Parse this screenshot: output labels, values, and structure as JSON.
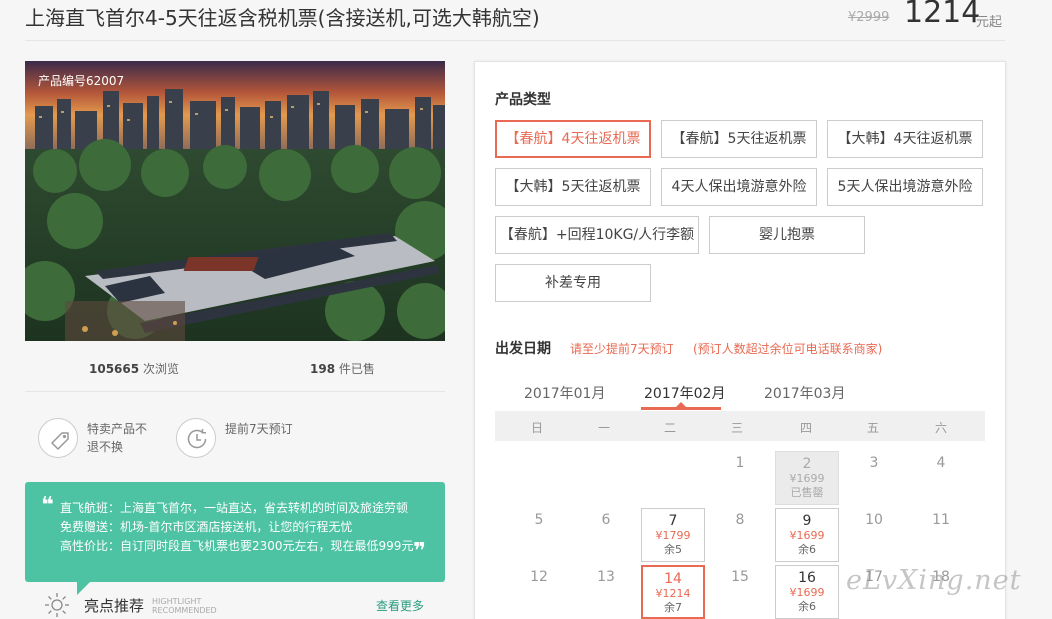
{
  "header": {
    "title": "上海直飞首尔4-5天往返含税机票(含接送机,可选大韩航空)",
    "old_price": "¥2999",
    "price": "1214",
    "price_unit": "元起"
  },
  "gallery": {
    "product_code": "产品编号62007"
  },
  "stats": {
    "views_count": "105665",
    "views_label": "次浏览",
    "sold_count": "198",
    "sold_label": "件已售"
  },
  "features": [
    {
      "icon": "tag-icon",
      "text": "特卖产品不退不换"
    },
    {
      "icon": "clock-icon",
      "text": "提前7天预订"
    }
  ],
  "highlights": {
    "lines": [
      "直飞航班：上海直飞首尔，一站直达，省去转机的时间及旅途劳顿",
      "免费赠送：机场-首尔市区酒店接送机，让您的行程无忧",
      "高性价比：自订同时段直飞机票也要2300元左右，现在最低999元"
    ],
    "title": "亮点推荐",
    "subtitle_en_1": "HIGHTLIGHT",
    "subtitle_en_2": "RECOMMENDED",
    "more_link": "查看更多"
  },
  "product_type": {
    "label": "产品类型",
    "options": [
      {
        "label": "【春航】4天往返机票",
        "selected": true
      },
      {
        "label": "【春航】5天往返机票",
        "selected": false
      },
      {
        "label": "【大韩】4天往返机票",
        "selected": false
      },
      {
        "label": "【大韩】5天往返机票",
        "selected": false
      },
      {
        "label": "4天人保出境游意外险",
        "selected": false
      },
      {
        "label": "5天人保出境游意外险",
        "selected": false
      },
      {
        "label": "【春航】+回程10KG/人行李额",
        "selected": false
      },
      {
        "label": "婴儿抱票",
        "selected": false
      },
      {
        "label": "补差专用",
        "selected": false
      }
    ]
  },
  "departure": {
    "label": "出发日期",
    "note1": "请至少提前7天预订",
    "note2": "(预订人数超过余位可电话联系商家)",
    "months": [
      "2017年01月",
      "2017年02月",
      "2017年03月"
    ],
    "active_month": "2017年02月",
    "weekdays": [
      "日",
      "一",
      "二",
      "三",
      "四",
      "五",
      "六"
    ],
    "days": [
      {
        "day": "1"
      },
      {
        "day": "2",
        "price": "¥1699",
        "remain": "已售罄",
        "status": "soldout"
      },
      {
        "day": "3"
      },
      {
        "day": "4"
      },
      {
        "day": "5"
      },
      {
        "day": "6"
      },
      {
        "day": "7",
        "price": "¥1799",
        "remain": "余5",
        "status": "available"
      },
      {
        "day": "8"
      },
      {
        "day": "9",
        "price": "¥1699",
        "remain": "余6",
        "status": "available"
      },
      {
        "day": "10"
      },
      {
        "day": "11"
      },
      {
        "day": "12"
      },
      {
        "day": "13"
      },
      {
        "day": "14",
        "price": "¥1214",
        "remain": "余7",
        "status": "selected"
      },
      {
        "day": "15"
      },
      {
        "day": "16",
        "price": "¥1699",
        "remain": "余6",
        "status": "available"
      },
      {
        "day": "17"
      },
      {
        "day": "18"
      }
    ]
  },
  "watermark": "eLvXing.net",
  "colors": {
    "accent": "#e86a53",
    "green": "#4dc3a3",
    "link_green": "#2a9d7f"
  }
}
